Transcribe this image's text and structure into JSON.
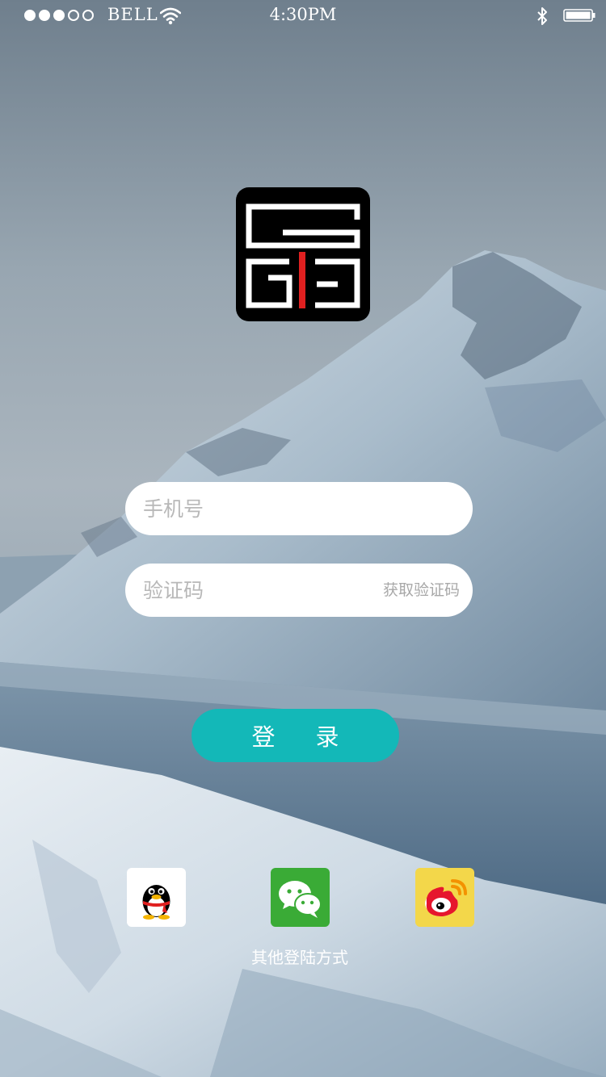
{
  "status_bar": {
    "signal_total": 5,
    "signal_filled": 3,
    "carrier": "BELL",
    "time": "4:30PM",
    "wifi_icon": "wifi-icon",
    "bluetooth_icon": "bluetooth-icon",
    "battery_icon": "battery-icon"
  },
  "logo": {
    "icon": "app-logo",
    "background": "#000000",
    "accent": "#e02020"
  },
  "login_form": {
    "phone_placeholder": "手机号",
    "code_placeholder": "验证码",
    "get_code_label": "获取验证码",
    "login_label": "登录"
  },
  "social_login": {
    "items": [
      {
        "icon": "qq-icon",
        "color": "#ffffff"
      },
      {
        "icon": "wechat-icon",
        "color": "#3aab36"
      },
      {
        "icon": "weibo-icon",
        "color": "#f3d74a"
      }
    ],
    "label": "其他登陆方式"
  },
  "colors": {
    "accent": "#13b8b8",
    "input_background": "#ffffff",
    "placeholder": "#b8b8b8"
  }
}
